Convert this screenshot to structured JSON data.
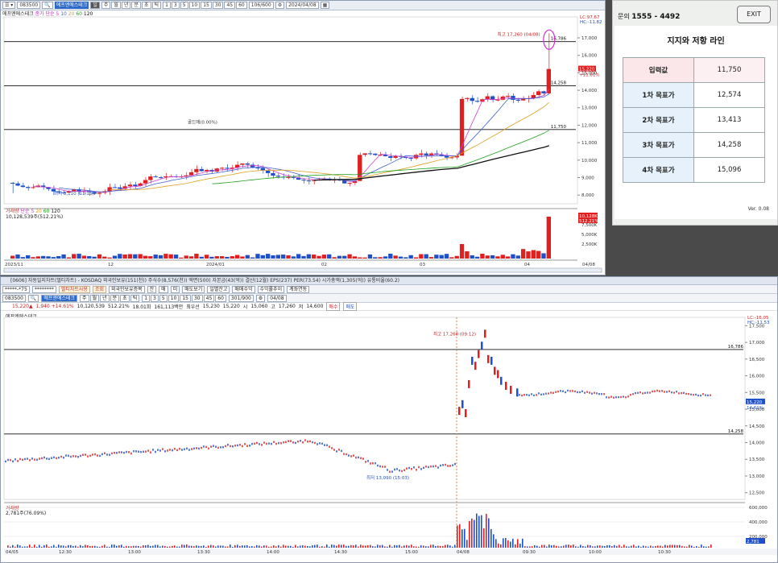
{
  "top_window": {
    "toolbar": {
      "code": "083500",
      "name": "에프엔에스테크",
      "mode": "일",
      "count": "106/600",
      "date": "2024/04/08",
      "periods": [
        "1",
        "3",
        "5",
        "10",
        "15",
        "30",
        "45",
        "60"
      ],
      "units": [
        "주",
        "월",
        "년",
        "분",
        "초",
        "틱"
      ]
    },
    "legend": {
      "name": "에프엔에스테크",
      "ma_label": "종가 단순",
      "ma": [
        "5",
        "10",
        "20",
        "60",
        "120"
      ]
    },
    "chart_data": [
      {
        "type": "candlestick",
        "title": "",
        "price_ticks": [
          "17,000",
          "16,000",
          "15,000",
          "14,000",
          "13,000",
          "12,000",
          "11,000",
          "10,000",
          "9,000",
          "8,000"
        ],
        "x_ticks": [
          "2023/11",
          "12",
          "2024/01",
          "02",
          "03",
          "04",
          "04/08"
        ],
        "ylim": [
          7500,
          18200
        ],
        "annotations": {
          "high": "최고 17,260 (04/08)",
          "low": "최저 8,110 (11/13)",
          "mid": "골드매(0.00%)"
        },
        "lines": [
          {
            "value": 16786,
            "label": "16,786"
          },
          {
            "value": 14258,
            "label": "14,258"
          },
          {
            "value": 11750,
            "label": "11,750"
          }
        ],
        "badges": {
          "lc": "LC:97.67",
          "hc": "HC:-11.82",
          "last": "15,220",
          "chg": "+11.81%"
        }
      },
      {
        "type": "bar",
        "legend": {
          "label": "거래량",
          "ma_label": "단순",
          "ma": [
            "5",
            "20",
            "60",
            "120"
          ]
        },
        "value_text": "10,128,539주(512.21%)",
        "ticks": [
          "7,500K",
          "5,000K",
          "2,500K"
        ],
        "badge": "10,128K",
        "badge2": "512.21%"
      }
    ]
  },
  "panel": {
    "inquiry_label": "문의",
    "phone": "1555 - 4492",
    "exit": "EXIT",
    "title": "지지와 저항 라인",
    "rows": [
      {
        "k": "입력값",
        "v": "11,750"
      },
      {
        "k": "1차 목표가",
        "v": "12,574"
      },
      {
        "k": "2차 목표가",
        "v": "13,413"
      },
      {
        "k": "3차 목표가",
        "v": "14,258"
      },
      {
        "k": "4차 목표가",
        "v": "15,096"
      }
    ],
    "version": "Ver. 0.08"
  },
  "bottom_window": {
    "title": "[0606] 자동일지차트(멀티차트) - KOSDAQ 외국인보유(151(천)) 주식수(8,576(천)) 액면(500) 자본금(43(억)) 결산(12월) EPS(237) PER(73.54) 시가총액(1,305(억)) 유통비율(60.2)",
    "row1": [
      "*****-*75",
      "********",
      "멀티차트사용",
      "조회",
      "외국인보유증목",
      "잔",
      "매",
      "미",
      "매도보기",
      "일별잔고",
      "매매수익",
      "수익률추이",
      "계좌연동"
    ],
    "row2": {
      "code": "083500",
      "name": "에프엔에스테크",
      "periods": [
        "1",
        "3",
        "5",
        "10",
        "15",
        "30",
        "45",
        "60"
      ],
      "units": [
        "주",
        "월",
        "년",
        "분",
        "초",
        "틱"
      ],
      "count": "301/900",
      "date": "04/08"
    },
    "price_row": [
      "15,220▲",
      "1,940 +14.61%",
      "10,120,539",
      "512.21%",
      "18.01회",
      "161,113백만",
      "최우선",
      "15,230",
      "15,220",
      "시",
      "15,060",
      "고",
      "17,260",
      "저",
      "14,600",
      "매수",
      "매도"
    ],
    "legend": "에프엔에스테크",
    "chart_data": [
      {
        "type": "line",
        "title": "",
        "price_ticks": [
          "17,500",
          "17,000",
          "16,500",
          "16,000",
          "15,500",
          "15,000",
          "14,500",
          "14,000",
          "13,500",
          "13,000",
          "12,500"
        ],
        "x_ticks": [
          "04/05",
          "12:30",
          "13:00",
          "13:30",
          "14:00",
          "14:30",
          "15:00",
          "04/08",
          "09:30",
          "10:00",
          "10:30"
        ],
        "ylim": [
          12300,
          17750
        ],
        "annotations": {
          "high": "최고 17,260 (09:12)",
          "low": "최저 13,090 (15:03)"
        },
        "lines": [
          {
            "value": 16786,
            "label": "16,786"
          },
          {
            "value": 14258,
            "label": "14,258"
          }
        ],
        "badges": {
          "lc": "LC:-16.05",
          "hc": "HC:-11.53",
          "last": "15,220",
          "chg": "14.61%"
        }
      },
      {
        "type": "bar",
        "legend": {
          "label": "거래량"
        },
        "value_text": "2,781주(76.09%)",
        "ticks": [
          "600,000",
          "400,000",
          "200,000"
        ],
        "badge": "2,781"
      }
    ]
  }
}
